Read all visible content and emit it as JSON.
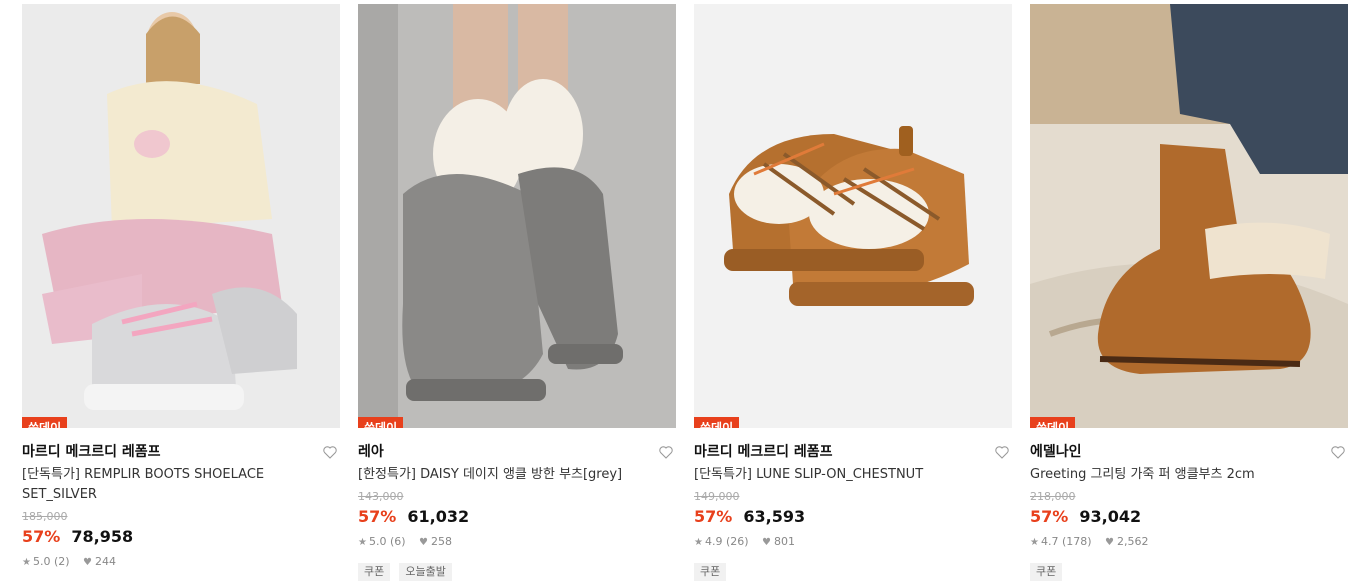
{
  "products": [
    {
      "badge": "쓱데이",
      "brand": "마르디 메크르디 레폼프",
      "title": "[단독특가] REMPLIR BOOTS SHOELACE SET_SILVER",
      "original_price": "185,000",
      "discount": "57%",
      "price": "78,958",
      "rating": "5.0 (2)",
      "likes": "244",
      "tags": [],
      "image_subject": "Model in cream puffer jacket and pink pants wearing silver lace-up boots"
    },
    {
      "badge": "쓱데이",
      "brand": "레아",
      "title": "[한정특가] DAISY 데이지 앵클 방한 부츠[grey]",
      "original_price": "143,000",
      "discount": "57%",
      "price": "61,032",
      "rating": "5.0 (6)",
      "likes": "258",
      "tags": [
        "쿠폰",
        "오늘출발"
      ],
      "image_subject": "Grey suede mini boots with fuzzy cream socks"
    },
    {
      "badge": "쓱데이",
      "brand": "마르디 메크르디 레폼프",
      "title": "[단독특가] LUNE SLIP-ON_CHESTNUT",
      "original_price": "149,000",
      "discount": "57%",
      "price": "63,593",
      "rating": "4.9 (26)",
      "likes": "801",
      "tags": [
        "쿠폰"
      ],
      "image_subject": "Chestnut platform slip-ons with fleece and braided laces"
    },
    {
      "badge": "쓱데이",
      "brand": "에델나인",
      "title": "Greeting 그리팅 가죽 퍼 앵클부츠 2cm",
      "original_price": "218,000",
      "discount": "57%",
      "price": "93,042",
      "rating": "4.7 (178)",
      "likes": "2,562",
      "tags": [
        "쿠폰"
      ],
      "image_subject": "Tan suede ankle boots with fur cuff, worn with jeans"
    }
  ],
  "colors": {
    "accent": "#e8401c"
  }
}
